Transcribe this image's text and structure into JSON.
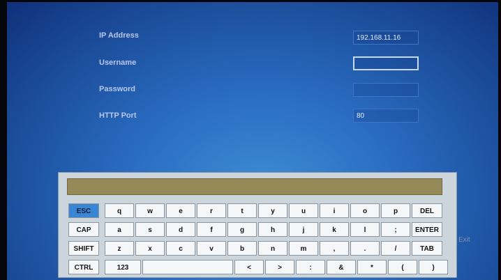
{
  "form": {
    "ip_label": "IP Address",
    "ip_value": "192.168.11.16",
    "username_label": "Username",
    "username_value": "",
    "password_label": "Password",
    "password_value": "",
    "port_label": "HTTP Port",
    "port_value": "80"
  },
  "keyboard": {
    "display_text": "",
    "rows": [
      [
        "ESC",
        "q",
        "w",
        "e",
        "r",
        "t",
        "y",
        "u",
        "i",
        "o",
        "p",
        "DEL"
      ],
      [
        "CAP",
        "a",
        "s",
        "d",
        "f",
        "g",
        "h",
        "j",
        "k",
        "l",
        ";",
        "ENTER"
      ],
      [
        "SHIFT",
        "z",
        "x",
        "c",
        "v",
        "b",
        "n",
        "m",
        ",",
        ".",
        "/",
        "TAB"
      ],
      [
        "CTRL",
        "123",
        "",
        "<",
        ">",
        ":",
        "&",
        "*",
        "(",
        ")"
      ]
    ]
  },
  "exit_label": "Exit",
  "colors": {
    "accent_esc": "#3a86d4",
    "display_bg": "#968b58"
  }
}
